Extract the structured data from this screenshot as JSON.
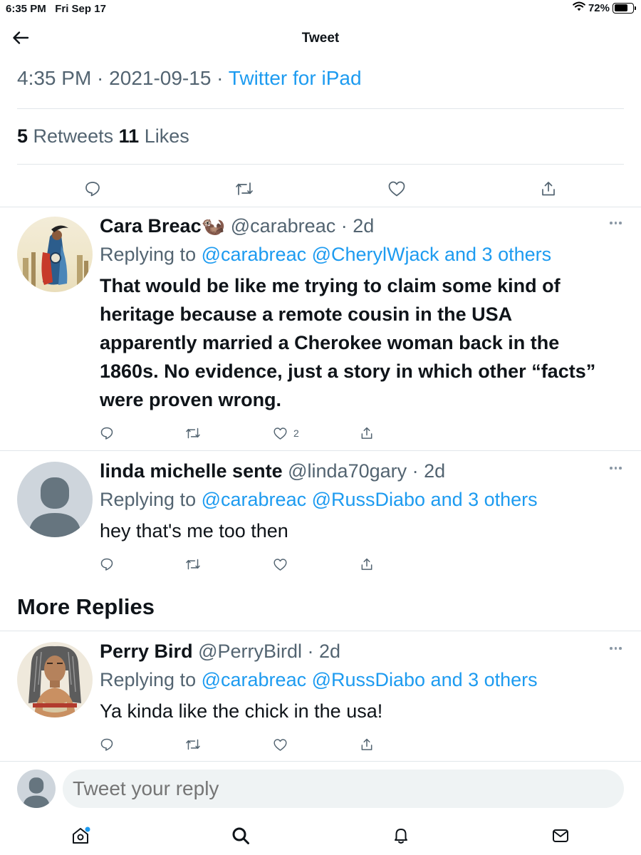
{
  "status_bar": {
    "time": "6:35 PM",
    "date": "Fri Sep 17",
    "battery": "72%",
    "battery_level": 0.72
  },
  "header": {
    "title": "Tweet",
    "back_icon": "arrow-left-icon"
  },
  "tweet_meta": {
    "time": "4:35 PM",
    "date": "2021-09-15",
    "source": "Twitter for iPad"
  },
  "stats": {
    "retweets_count": "5",
    "retweets_label": "Retweets",
    "likes_count": "11",
    "likes_label": "Likes"
  },
  "main_actions": [
    "comment-icon",
    "retweet-icon",
    "heart-icon",
    "share-icon"
  ],
  "replies": [
    {
      "name": "Cara Breac",
      "emoji": "🦦",
      "handle": "@carabreac",
      "time": "2d",
      "replying_prefix": "Replying to",
      "mentions": "@carabreac @CherylWjack and 3 others",
      "text": "That would be like me trying to claim some kind of heritage because a remote cousin in the USA apparently married a Cherokee woman back in the 1860s. No evidence, just a story in which other “facts” were proven wrong.",
      "like_count": "2"
    },
    {
      "name": "linda michelle sente",
      "handle": "@linda70gary",
      "time": "2d",
      "replying_prefix": "Replying to",
      "mentions": "@carabreac @RussDiabo and 3 others",
      "text": "hey that's me too then"
    }
  ],
  "more_replies_heading": "More Replies",
  "more_replies": [
    {
      "name": "Perry Bird",
      "handle": "@PerryBirdl",
      "time": "2d",
      "replying_prefix": "Replying to",
      "mentions": "@carabreac @RussDiabo and 3 others",
      "text": "Ya kinda like the chick in the usa!"
    }
  ],
  "compose": {
    "placeholder": "Tweet your reply"
  },
  "tab_bar": [
    "home-icon",
    "search-icon",
    "notifications-icon",
    "messages-icon"
  ],
  "colors": {
    "accent": "#1d9bf0",
    "secondary_text": "#536471",
    "divider": "#e1e6ea"
  }
}
